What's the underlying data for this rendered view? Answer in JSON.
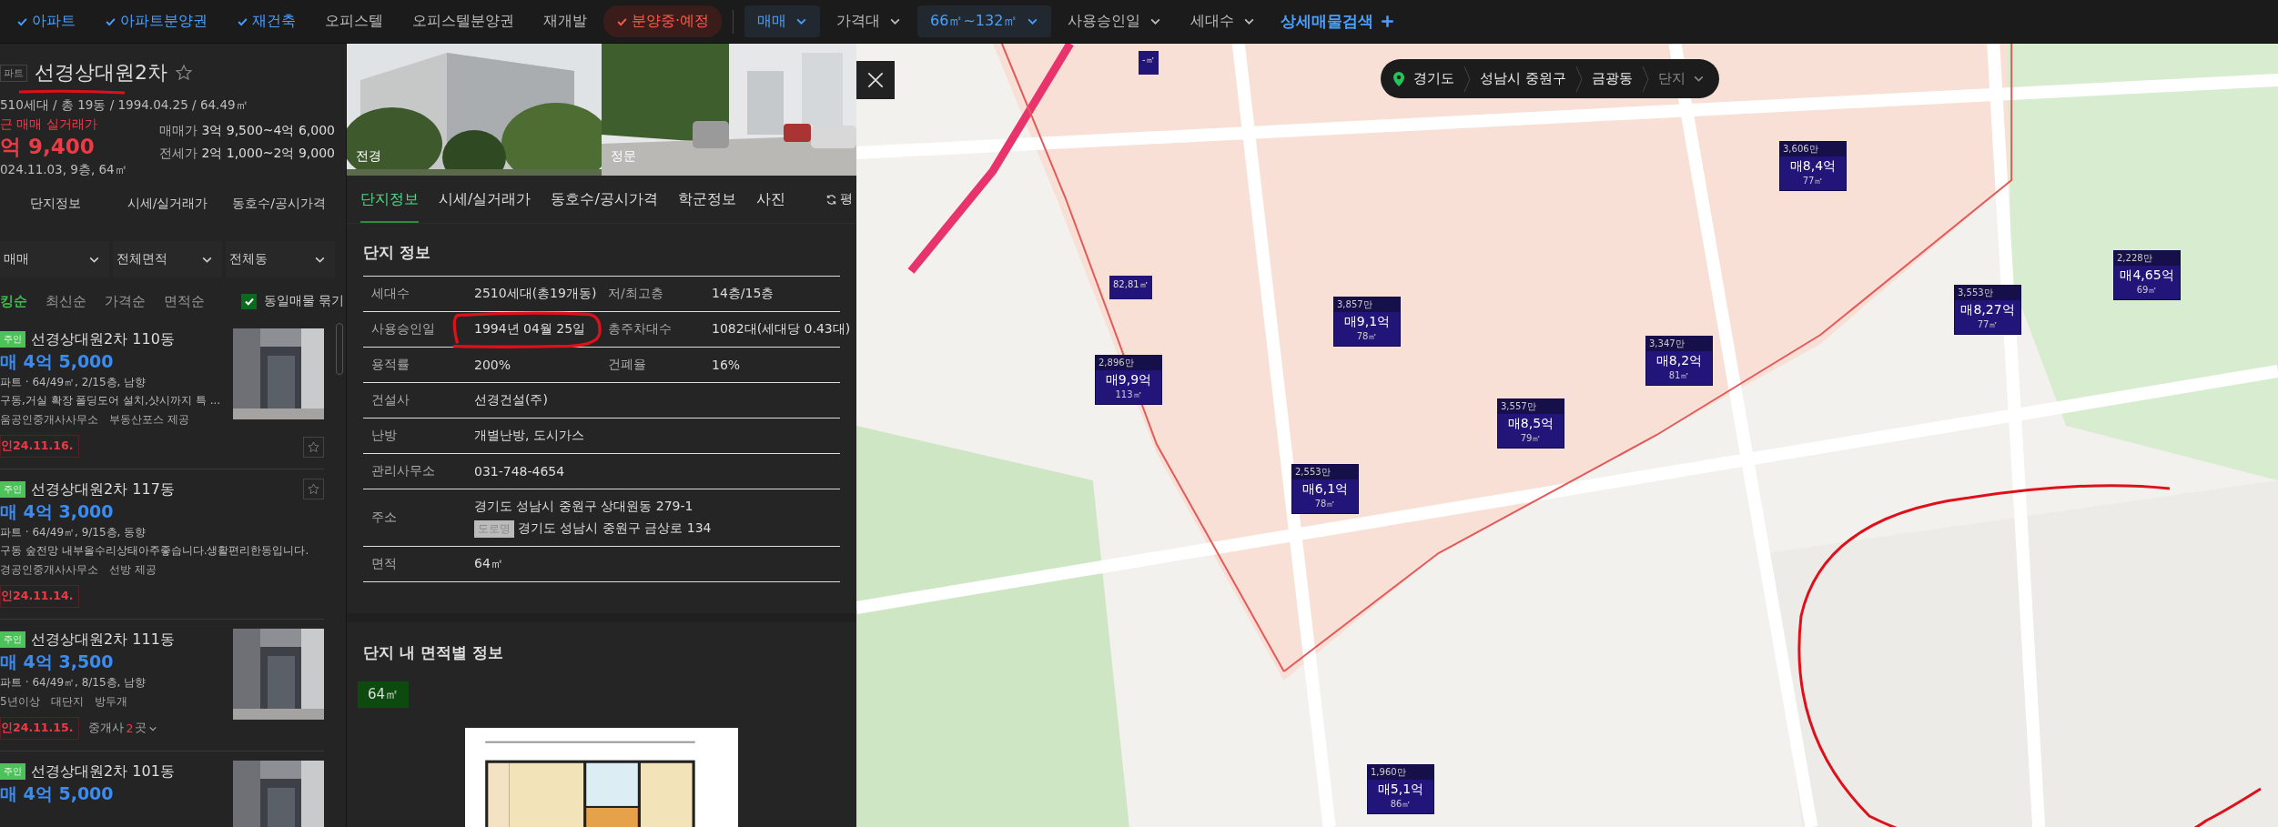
{
  "filter_bar": {
    "types": [
      {
        "label": "아파트",
        "checked": true,
        "kind": "normal"
      },
      {
        "label": "아파트분양권",
        "checked": true,
        "kind": "normal"
      },
      {
        "label": "재건축",
        "checked": true,
        "kind": "normal"
      },
      {
        "label": "오피스텔",
        "checked": false,
        "kind": "normal"
      },
      {
        "label": "오피스텔분양권",
        "checked": false,
        "kind": "normal"
      },
      {
        "label": "재개발",
        "checked": false,
        "kind": "normal"
      },
      {
        "label": "분양중·예정",
        "checked": true,
        "kind": "alert"
      }
    ],
    "dropdowns": [
      {
        "label": "매매",
        "active": true
      },
      {
        "label": "가격대",
        "active": false
      },
      {
        "label": "66㎡~132㎡",
        "active": true
      },
      {
        "label": "사용승인일",
        "active": false
      },
      {
        "label": "세대수",
        "active": false
      }
    ],
    "detail_search": "상세매물검색"
  },
  "complex": {
    "type_badge": "파트",
    "name": "선경상대원2차",
    "favorite": false,
    "summary": "510세대 / 총 19동 / 1994.04.25 / 64.49㎡",
    "recent_label": "근 매매 실거래가",
    "recent_price": "억 9,400",
    "recent_detail": "024.11.03, 9층, 64㎡",
    "price_ranges": [
      {
        "label": "매매가",
        "value": "3억 9,500~4억 6,000"
      },
      {
        "label": "전세가",
        "value": "2억 1,000~2억 9,000"
      }
    ]
  },
  "left_tabs": [
    {
      "label": "단지정보",
      "selected": false
    },
    {
      "label": "시세/실거래가",
      "selected": false
    },
    {
      "label": "동호수/공시가격",
      "selected": false
    }
  ],
  "left_filters": [
    {
      "label": "매매"
    },
    {
      "label": "전체면적"
    },
    {
      "label": "전체동"
    }
  ],
  "sort_options": [
    {
      "label": "킹순",
      "selected": true
    },
    {
      "label": "최신순",
      "selected": false
    },
    {
      "label": "가격순",
      "selected": false
    },
    {
      "label": "면적순",
      "selected": false
    }
  ],
  "group_same": {
    "label": "동일매물 묶기",
    "checked": true
  },
  "listings": [
    {
      "badge": "주인",
      "title": "선경상대원2차 110동",
      "price": "매 4억 5,000",
      "specs": "파트 · 64/49㎡, 2/15층, 남향",
      "desc": "구동,거실 확장 폴딩도어 설치,샷시까지 특 ...",
      "meta": [
        "움공인중개사사무소",
        "부동산포스 제공"
      ],
      "confirmed": "인24.11.16.",
      "photo": true,
      "favorite_button": true
    },
    {
      "badge": "주인",
      "title": "선경상대원2차 117동",
      "price": "매 4억 3,000",
      "specs": "파트 · 64/49㎡, 9/15층, 동향",
      "desc": "구동 숲전망 내부올수리상태아주좋습니다.생활편리한동입니다.",
      "meta": [
        "경공인중개사사무소",
        "선방 제공"
      ],
      "confirmed": "인24.11.14.",
      "photo": false,
      "favorite_button": true
    },
    {
      "badge": "주인",
      "title": "선경상대원2차 111동",
      "price": "매 4억 3,500",
      "specs": "파트 · 64/49㎡, 8/15층, 남향",
      "meta": [
        "5년이상",
        "대단지",
        "방두개"
      ],
      "confirmed": "인24.11.15.",
      "brokers": {
        "prefix": "중개사",
        "count": "2",
        "suffix": "곳"
      },
      "photo": true,
      "favorite_button": false
    },
    {
      "badge": "주인",
      "title": "선경상대원2차 101동",
      "price": "매 4억 5,000",
      "photo": true,
      "favorite_button": false
    }
  ],
  "photos": [
    {
      "caption": "전경"
    },
    {
      "caption": "정문"
    }
  ],
  "detail_tabs": [
    {
      "label": "단지정보",
      "selected": true
    },
    {
      "label": "시세/실거래가",
      "selected": false
    },
    {
      "label": "동호수/공시가격",
      "selected": false
    },
    {
      "label": "학군정보",
      "selected": false
    },
    {
      "label": "사진",
      "selected": false
    }
  ],
  "unit_toggle": "평",
  "complex_info": {
    "title": "단지 정보",
    "rows": [
      {
        "label": "세대수",
        "value": "2510세대(총19개동)",
        "label_2": "저/최고층",
        "value_2": "14층/15층"
      },
      {
        "label": "사용승인일",
        "value": "1994년 04월 25일",
        "label_2": "총주차대수",
        "value_2": "1082대(세대당 0.43대)"
      },
      {
        "label": "용적률",
        "value": "200%",
        "label_2": "건폐율",
        "value_2": "16%"
      },
      {
        "label": "건설사",
        "value": "선경건설(주)"
      },
      {
        "label": "난방",
        "value": "개별난방, 도시가스"
      },
      {
        "label": "관리사무소",
        "value": "031-748-4654"
      },
      {
        "label": "주소",
        "value": "경기도 성남시 중원구 상대원동 279-1",
        "road_badge": "도로명",
        "road_address": "경기도 성남시 중원구 금상로 134"
      },
      {
        "label": "면적",
        "value": "64㎡"
      }
    ]
  },
  "area_section": {
    "title": "단지 내 면적별 정보",
    "areas": [
      {
        "label": "64㎡",
        "selected": true
      }
    ]
  },
  "map": {
    "breadcrumb": [
      "경기도",
      "성남시 중원구",
      "금광동"
    ],
    "level_dropdown": "단지",
    "markers": [
      {
        "kind": "price",
        "count": "3,606만",
        "price": "매8,4억",
        "area": "77㎡"
      },
      {
        "kind": "price",
        "count": "2,228만",
        "price": "매4,65억",
        "area": "69㎡"
      },
      {
        "kind": "price",
        "count": "3,553만",
        "price": "매8,27억",
        "area": "77㎡"
      },
      {
        "kind": "price",
        "count": "3,857만",
        "price": "매9,1억",
        "area": "78㎡"
      },
      {
        "kind": "price",
        "count": "3,347만",
        "price": "매8,2억",
        "area": "81㎡"
      },
      {
        "kind": "price",
        "count": "2,896만",
        "price": "매9,9억",
        "area": "113㎡"
      },
      {
        "kind": "price",
        "count": "3,557만",
        "price": "매8,5억",
        "area": "79㎡"
      },
      {
        "kind": "price",
        "count": "2,553만",
        "price": "매6,1억",
        "area": "78㎡"
      },
      {
        "kind": "price",
        "count": "1,960만",
        "price": "매5,1억",
        "area": "86㎡"
      },
      {
        "kind": "area",
        "area": "-㎡"
      },
      {
        "kind": "area",
        "area": "82,81㎡"
      }
    ]
  }
}
